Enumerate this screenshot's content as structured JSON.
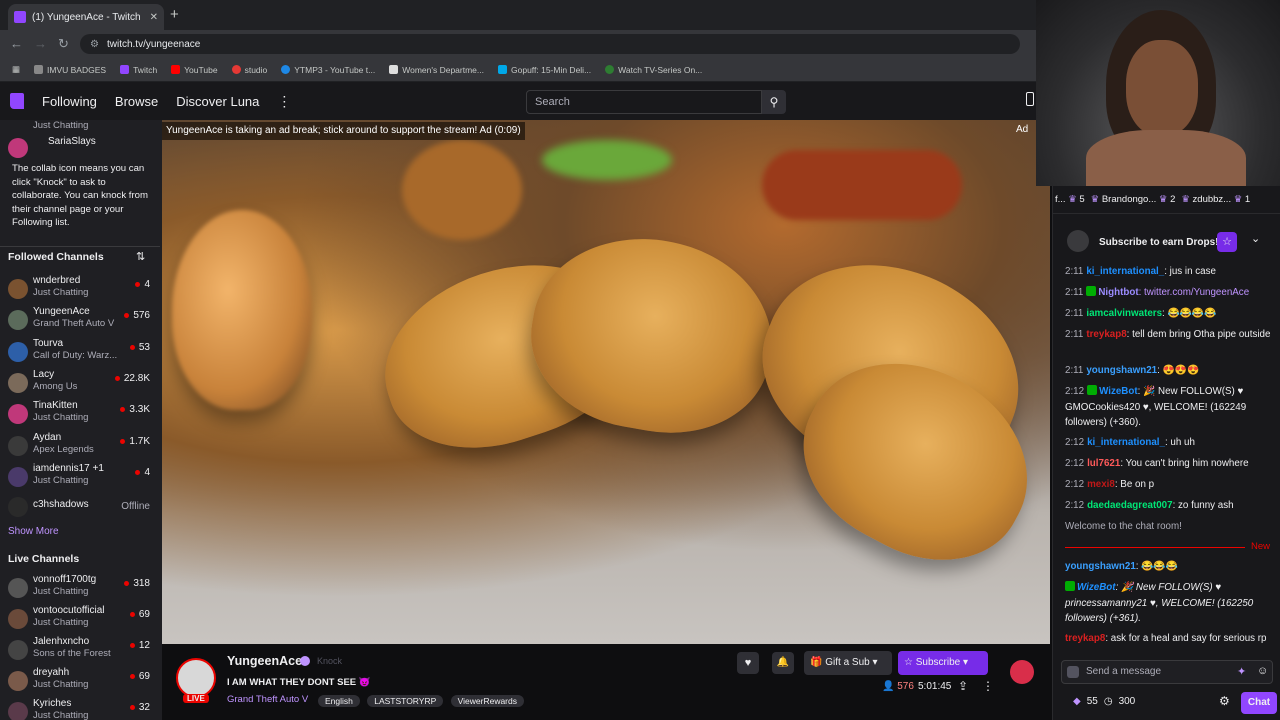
{
  "browser": {
    "tab_title": "(1) YungeenAce - Twitch",
    "url": "twitch.tv/yungeenace",
    "bookmarks": [
      "IMVU BADGES",
      "Twitch",
      "YouTube",
      "studio",
      "YTMP3 - YouTube t...",
      "Women's Departme...",
      "Gopuff: 15-Min Deli...",
      "Watch TV-Series On..."
    ]
  },
  "topnav": {
    "following": "Following",
    "browse": "Browse",
    "discover": "Discover Luna",
    "search_placeholder": "Search"
  },
  "sidebar": {
    "partial_top_game": "Just Chatting",
    "partial_top_name": "SariaSlays",
    "tooltip": "The collab icon means you can click \"Knock\" to ask to collaborate. You can knock from their channel page or your Following list.",
    "followed_header": "Followed Channels",
    "followed": [
      {
        "name": "wnderbred",
        "game": "Just Chatting",
        "count": "4",
        "color": "#7a5230"
      },
      {
        "name": "YungeenAce",
        "game": "Grand Theft Auto V",
        "count": "576",
        "color": "#5b6b5b"
      },
      {
        "name": "Tourva",
        "game": "Call of Duty: Warz...",
        "count": "53",
        "color": "#2d5fa8"
      },
      {
        "name": "Lacy",
        "game": "Among Us",
        "count": "22.8K",
        "color": "#7b6a5a"
      },
      {
        "name": "TinaKitten",
        "game": "Just Chatting",
        "count": "3.3K",
        "color": "#c0387a"
      },
      {
        "name": "Aydan",
        "game": "Apex Legends",
        "count": "1.7K",
        "color": "#3a3a3a"
      },
      {
        "name": "iamdennis17 +1",
        "game": "Just Chatting",
        "count": "4",
        "color": "#4a3a6a"
      },
      {
        "name": "c3hshadows",
        "game": "",
        "count": "Offline",
        "color": "#2a2a2a"
      }
    ],
    "show_more": "Show More",
    "live_header": "Live Channels",
    "live": [
      {
        "name": "vonnoff1700tg",
        "game": "Just Chatting",
        "count": "318",
        "color": "#555"
      },
      {
        "name": "vontoocutofficial",
        "game": "Just Chatting",
        "count": "69",
        "color": "#6a4a3a"
      },
      {
        "name": "Jalenhxncho",
        "game": "Sons of the Forest",
        "count": "12",
        "color": "#444"
      },
      {
        "name": "dreyahh",
        "game": "Just Chatting",
        "count": "69",
        "color": "#7a5a4a"
      },
      {
        "name": "Kyriches",
        "game": "Just Chatting",
        "count": "32",
        "color": "#5a3a4a"
      }
    ]
  },
  "video": {
    "ad_notice": "YungeenAce is taking an ad break; stick around to support the stream! Ad (0:09)",
    "ad_tag": "Ad"
  },
  "stream": {
    "channel": "YungeenAce",
    "knock": "Knock",
    "title": "I AM WHAT THEY DONT SEE",
    "game": "Grand Theft Auto V",
    "tags": [
      "English",
      "LASTSTORYRP",
      "ViewerRewards"
    ],
    "live_label": "LIVE",
    "viewers": "576",
    "uptime": "5:01:45",
    "gift_label": "Gift a Sub",
    "subscribe_label": "Subscribe"
  },
  "chat": {
    "leaderboard": [
      {
        "name": "f...",
        "count": "5"
      },
      {
        "name": "Brandongo...",
        "count": "2"
      },
      {
        "name": "zdubbz...",
        "count": "1"
      }
    ],
    "drops_label": "Subscribe to earn Drops!",
    "messages": [
      {
        "time": "2:11",
        "user": "ki_international_",
        "color": "#1e90ff",
        "text": ": jus in case"
      },
      {
        "time": "2:11",
        "user": "Nightbot",
        "color": "#9b8cff",
        "text": ": twitter.com/YungeenAce",
        "textcolor": "#bf94ff"
      },
      {
        "time": "2:11",
        "user": "iamcalvinwaters",
        "color": "#00e676",
        "text": ": 😂😂😂😂"
      },
      {
        "time": "2:11",
        "user": "treykap8",
        "color": "#d92020",
        "text": ": tell dem bring Otha pipe outside"
      },
      {
        "time": "2:11",
        "user": "youngshawn21",
        "color": "#3aa0ff",
        "text": ": 😍😍😍"
      },
      {
        "time": "2:12",
        "user": "WizeBot",
        "color": "#1e90ff",
        "text": ": 🎉 New FOLLOW(S) ♥ GMOCookies420 ♥, WELCOME! (162249 followers) (+360)."
      },
      {
        "time": "2:12",
        "user": "ki_international_",
        "color": "#1e90ff",
        "text": ": uh uh"
      },
      {
        "time": "2:12",
        "user": "lul7621",
        "color": "#ff5a5a",
        "text": ": You can't bring him nowhere"
      },
      {
        "time": "2:12",
        "user": "mexi8",
        "color": "#c01818",
        "text": ": Be on p"
      },
      {
        "time": "2:12",
        "user": "daedaedagreat007",
        "color": "#00e676",
        "text": ": zo funny ash"
      }
    ],
    "welcome": "Welcome to the chat room!",
    "new_label": "New",
    "after_messages": [
      {
        "user": "youngshawn21",
        "color": "#3aa0ff",
        "text": ": 😂😂😂"
      },
      {
        "user": "WizeBot",
        "color": "#1e90ff",
        "text": ": 🎉 New FOLLOW(S) ♥ princessamanny21 ♥, WELCOME! (162250 followers) (+361)."
      },
      {
        "user": "treykap8",
        "color": "#d92020",
        "text": ": ask for a heal and say for serious rp"
      }
    ],
    "input_placeholder": "Send a message",
    "bits": "55",
    "points": "300",
    "chat_button": "Chat"
  }
}
